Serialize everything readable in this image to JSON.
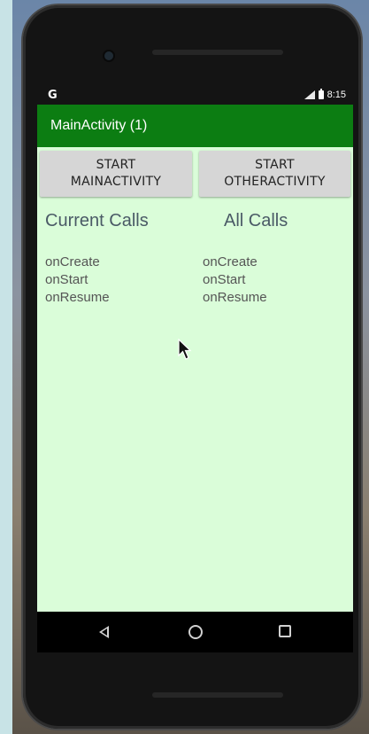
{
  "status_bar": {
    "carrier_glyph": "G",
    "time": "8:15"
  },
  "app_bar": {
    "title": "MainActivity (1)"
  },
  "buttons": {
    "start_main": "START\nMAINACTIVITY",
    "start_other": "START\nOTHERACTIVITY"
  },
  "current_calls": {
    "heading": "Current Calls",
    "items": [
      "onCreate",
      "onStart",
      "onResume"
    ]
  },
  "all_calls": {
    "heading": "All Calls",
    "items": [
      "onCreate",
      "onStart",
      "onResume"
    ]
  },
  "nav_bar": {
    "icons": [
      "back-icon",
      "home-icon",
      "recents-icon"
    ]
  },
  "colors": {
    "app_bar": "#0c7d12",
    "content_background": "#dafdd9",
    "button_background": "#d6d6d6"
  }
}
